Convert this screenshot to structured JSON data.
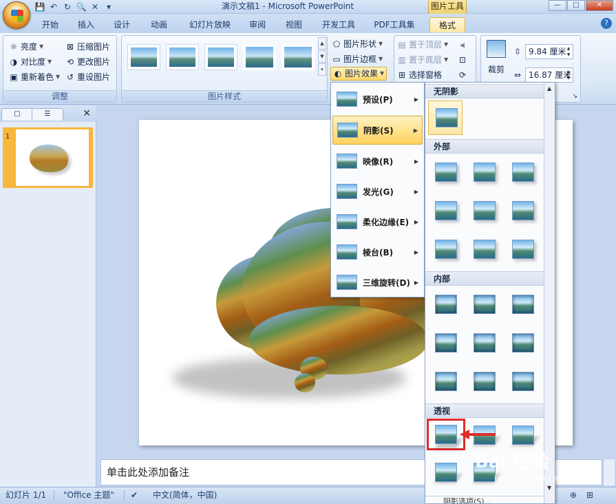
{
  "window": {
    "title": "演示文稿1 - Microsoft PowerPoint",
    "context_tool": "图片工具",
    "controls": {
      "min": "—",
      "max": "□",
      "close": "✕"
    }
  },
  "tabs": [
    "开始",
    "插入",
    "设计",
    "动画",
    "幻灯片放映",
    "审阅",
    "视图",
    "开发工具",
    "PDF工具集",
    "格式"
  ],
  "active_tab": "格式",
  "ribbon": {
    "adjust": {
      "label": "调整",
      "brightness": "亮度",
      "contrast": "对比度",
      "recolor": "重新着色",
      "compress": "压缩图片",
      "change_picture": "更改图片",
      "reset_picture": "重设图片"
    },
    "picture_styles": {
      "label": "图片样式",
      "shape": "图片形状",
      "border": "图片边框",
      "effects": "图片效果"
    },
    "arrange": {
      "bring_front": "置于顶层",
      "send_back": "置于底层",
      "selection_pane": "选择窗格"
    },
    "size": {
      "crop": "裁剪",
      "height": "9.84 厘米",
      "width": "16.87 厘米"
    }
  },
  "slides_pane": {
    "slide_number": "1"
  },
  "effects_menu": {
    "items": [
      {
        "label": "预设(P)"
      },
      {
        "label": "阴影(S)"
      },
      {
        "label": "映像(R)"
      },
      {
        "label": "发光(G)"
      },
      {
        "label": "柔化边缘(E)"
      },
      {
        "label": "棱台(B)"
      },
      {
        "label": "三维旋转(D)"
      }
    ],
    "highlighted": 1
  },
  "shadow_gallery": {
    "sections": {
      "none": "无阴影",
      "outer": "外部",
      "inner": "内部",
      "perspective": "透视"
    },
    "footer": "阴影选项(S)..."
  },
  "notes_placeholder": "单击此处添加备注",
  "status": {
    "slide": "幻灯片 1/1",
    "theme": "\"Office 主题\"",
    "language": "中文(简体，中国)"
  },
  "watermark": {
    "main": "Bai 经验",
    "sub": "jingyan.baidu.com"
  }
}
